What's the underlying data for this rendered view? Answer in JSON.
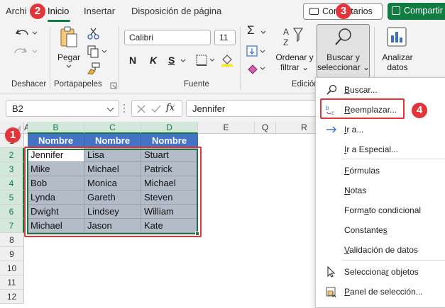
{
  "tabs": {
    "items": [
      {
        "label": "Archivo",
        "visible": "Archi"
      },
      {
        "label": "Inicio"
      },
      {
        "label": "Insertar"
      },
      {
        "label": "Disposición de página"
      }
    ],
    "comments_label": "Comentarios",
    "share_label": "Compartir"
  },
  "ribbon": {
    "groups": {
      "undo": "Deshacer",
      "clipboard": "Portapapeles",
      "font": "Fuente",
      "editing": "Edición"
    },
    "paste_label": "Pegar",
    "font_name": "Calibri",
    "font_size": "11",
    "bold": "N",
    "italic": "K",
    "underline": "S",
    "sort_filter_label_1": "Ordenar y",
    "sort_filter_label_2": "filtrar",
    "find_select_label_1": "Buscar y",
    "find_select_label_2": "seleccionar",
    "analyze_label_1": "Analizar",
    "analyze_label_2": "datos"
  },
  "formula_bar": {
    "name_box": "B2",
    "fx": "fx",
    "content": "Jennifer"
  },
  "sheet": {
    "columns": [
      "A",
      "B",
      "C",
      "D",
      "E",
      "Q",
      "R"
    ],
    "rows": [
      "1",
      "2",
      "3",
      "4",
      "5",
      "6",
      "7",
      "8",
      "9",
      "10",
      "11",
      "12"
    ],
    "header_cells": [
      "Nombre",
      "Nombre",
      "Nombre"
    ],
    "data": [
      [
        "Jennifer",
        "Lisa",
        "Stuart"
      ],
      [
        "Mike",
        "Michael",
        "Patrick"
      ],
      [
        "Bob",
        "Monica",
        "Michael"
      ],
      [
        "Lynda",
        "Gareth",
        "Steven"
      ],
      [
        "Dwight",
        "Lindsey",
        "William"
      ],
      [
        "Michael",
        "Jason",
        "Kate"
      ]
    ]
  },
  "dropdown": {
    "items": [
      {
        "pre": "",
        "u": "B",
        "post": "uscar...",
        "icon": "magnifier-icon"
      },
      {
        "pre": "",
        "u": "R",
        "post": "eemplazar...",
        "icon": "replace-icon"
      },
      {
        "pre": "",
        "u": "I",
        "post": "r a...",
        "icon": "arrow-right-icon"
      },
      {
        "pre": "",
        "u": "I",
        "post": "r a Especial...",
        "icon": ""
      },
      {
        "pre": "",
        "u": "F",
        "post": "órmulas",
        "icon": ""
      },
      {
        "pre": "",
        "u": "N",
        "post": "otas",
        "icon": ""
      },
      {
        "pre": "Form",
        "u": "a",
        "post": "to condicional",
        "icon": ""
      },
      {
        "pre": "Constante",
        "u": "s",
        "post": "",
        "icon": ""
      },
      {
        "pre": "",
        "u": "V",
        "post": "alidación de datos",
        "icon": ""
      },
      {
        "pre": "Selecciona",
        "u": "r",
        "post": " objetos",
        "icon": "cursor-icon"
      },
      {
        "pre": "",
        "u": "P",
        "post": "anel de selección...",
        "icon": "selection-pane-icon"
      }
    ]
  },
  "badges": [
    "1",
    "2",
    "3",
    "4"
  ],
  "colors": {
    "accent_green": "#107c41",
    "header_blue": "#4472c4",
    "badge_red": "#e3343a"
  }
}
